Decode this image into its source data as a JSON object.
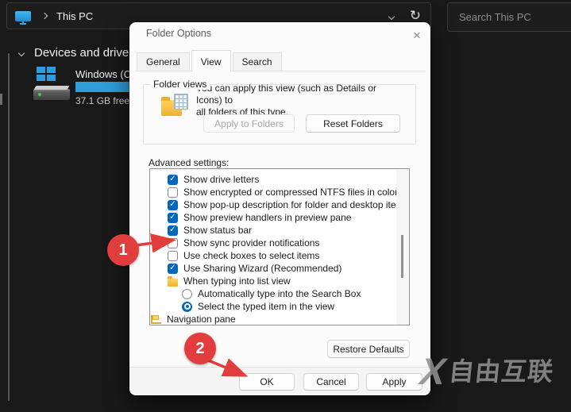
{
  "explorer": {
    "breadcrumb": {
      "location": "This PC"
    },
    "search": {
      "placeholder": "Search This PC"
    },
    "section_header": "Devices and drives",
    "drive": {
      "name": "Windows (C:)",
      "free_text": "37.1 GB free"
    }
  },
  "dialog": {
    "title": "Folder Options",
    "close_glyph": "×",
    "tabs": [
      {
        "label": "General"
      },
      {
        "label": "View"
      },
      {
        "label": "Search"
      }
    ],
    "folder_views": {
      "group_label": "Folder views",
      "description_line1": "You can apply this view (such as Details or Icons) to",
      "description_line2": "all folders of this type.",
      "apply_button": "Apply to Folders",
      "reset_button": "Reset Folders"
    },
    "advanced": {
      "label": "Advanced settings:",
      "items": [
        {
          "label": "Show drive letters",
          "state": "checked"
        },
        {
          "label": "Show encrypted or compressed NTFS files in color",
          "state": "unchecked"
        },
        {
          "label": "Show pop-up description for folder and desktop items",
          "state": "checked"
        },
        {
          "label": "Show preview handlers in preview pane",
          "state": "checked"
        },
        {
          "label": "Show status bar",
          "state": "checked"
        },
        {
          "label": "Show sync provider notifications",
          "state": "unchecked"
        },
        {
          "label": "Use check boxes to select items",
          "state": "unchecked"
        },
        {
          "label": "Use Sharing Wizard (Recommended)",
          "state": "checked"
        },
        {
          "label": "When typing into list view",
          "state": "folder"
        },
        {
          "label": "Automatically type into the Search Box",
          "state": "radio-off"
        },
        {
          "label": "Select the typed item in the view",
          "state": "radio-on"
        },
        {
          "label": "Navigation pane",
          "state": "tree"
        }
      ]
    },
    "buttons": {
      "restore_defaults": "Restore Defaults",
      "ok": "OK",
      "cancel": "Cancel",
      "apply": "Apply"
    }
  },
  "annotations": {
    "step1": "1",
    "step2": "2",
    "accent_color": "#e23d3d"
  },
  "watermark": {
    "logo": "X",
    "text": "自由互联"
  },
  "colors": {
    "window_background": "#191919",
    "dialog_background": "#fbfbfb",
    "checkbox_accent": "#0067c0",
    "drive_usage_bar": "#2f9ddb",
    "annotation_red": "#e23d3d"
  }
}
